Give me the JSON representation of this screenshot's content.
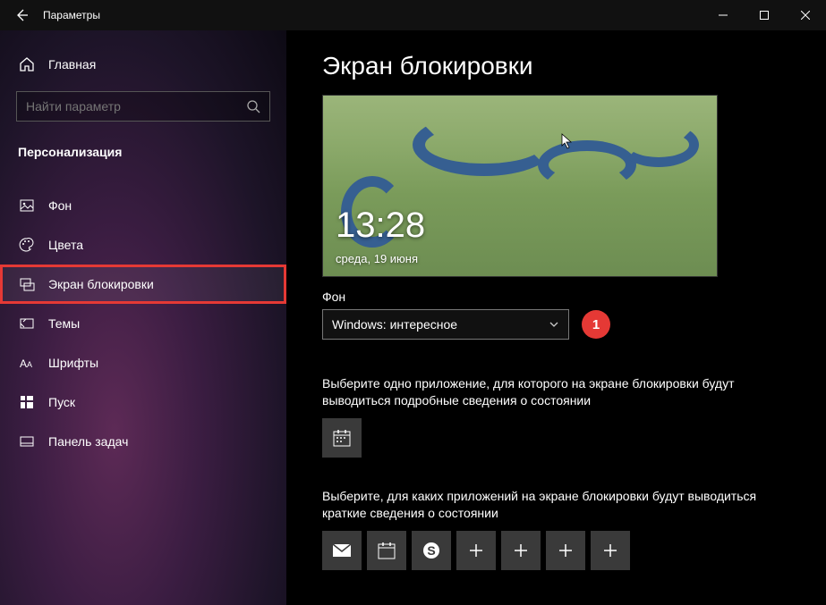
{
  "window": {
    "title": "Параметры"
  },
  "sidebar": {
    "home": "Главная",
    "search_placeholder": "Найти параметр",
    "section": "Персонализация",
    "items": [
      {
        "label": "Фон",
        "icon": "picture"
      },
      {
        "label": "Цвета",
        "icon": "palette"
      },
      {
        "label": "Экран блокировки",
        "icon": "lockscreen",
        "selected": true
      },
      {
        "label": "Темы",
        "icon": "themes"
      },
      {
        "label": "Шрифты",
        "icon": "fonts"
      },
      {
        "label": "Пуск",
        "icon": "start"
      },
      {
        "label": "Панель задач",
        "icon": "taskbar"
      }
    ]
  },
  "main": {
    "title": "Экран блокировки",
    "preview": {
      "time": "13:28",
      "date": "среда, 19 июня"
    },
    "background": {
      "label": "Фон",
      "value": "Windows: интересное",
      "annotation": "1"
    },
    "detailed": {
      "desc": "Выберите одно приложение, для которого на экране блокировки будут выводиться подробные сведения о состоянии",
      "tiles": [
        "calendar"
      ]
    },
    "quick": {
      "desc": "Выберите, для каких приложений на экране блокировки будут выводиться краткие сведения о состоянии",
      "tiles": [
        "mail",
        "calendar",
        "skype",
        "plus",
        "plus",
        "plus",
        "plus"
      ]
    }
  }
}
